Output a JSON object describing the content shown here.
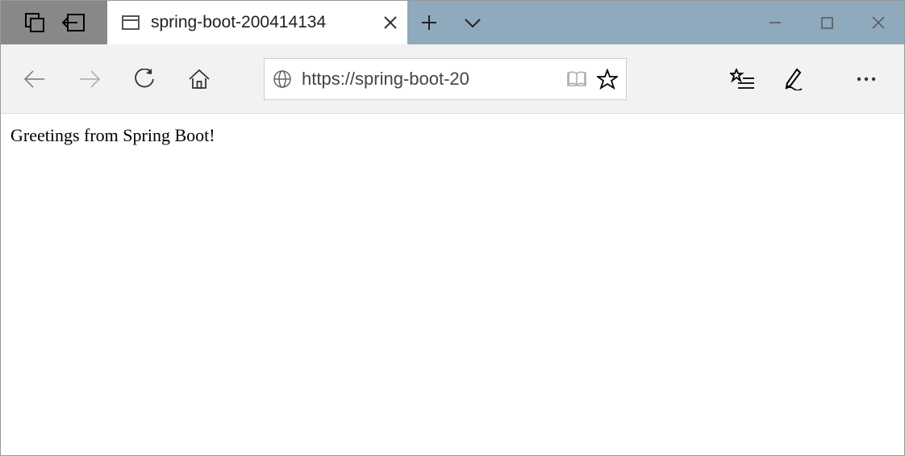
{
  "tab": {
    "title": "spring-boot-200414134"
  },
  "addressbar": {
    "url": "https://spring-boot-20"
  },
  "page": {
    "body_text": "Greetings from Spring Boot!"
  }
}
